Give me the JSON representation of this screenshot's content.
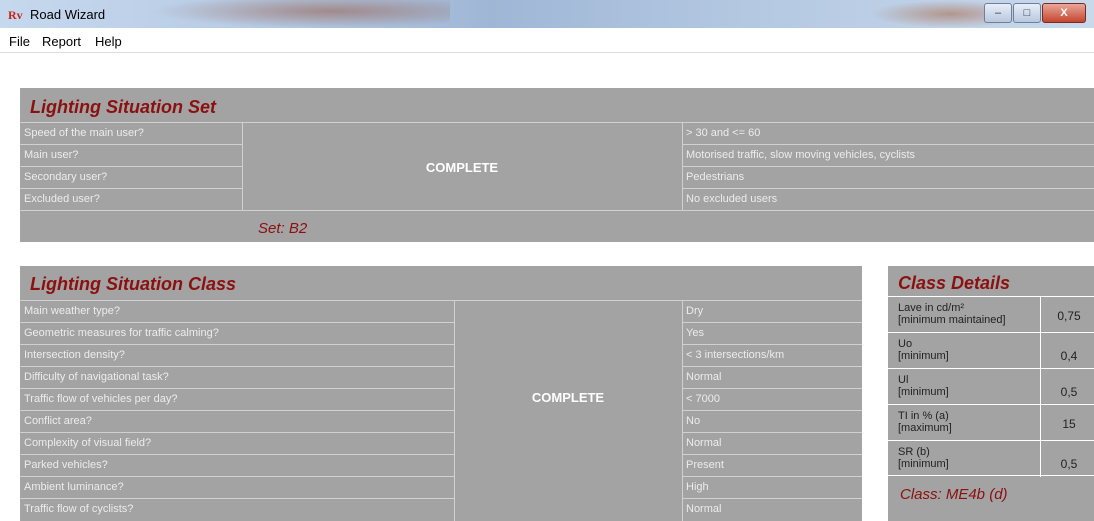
{
  "window": {
    "app_icon": "Rv",
    "title": "Road Wizard",
    "min": "–",
    "max": "□",
    "close": "X"
  },
  "menu": [
    "File",
    "Report",
    "Help"
  ],
  "set_panel": {
    "title": "Lighting Situation Set",
    "status": "COMPLETE",
    "rows": [
      {
        "question": "Speed of the main user?",
        "answer": "> 30 and <= 60"
      },
      {
        "question": "Main user?",
        "answer": "Motorised traffic, slow moving vehicles, cyclists"
      },
      {
        "question": "Secondary user?",
        "answer": "Pedestrians"
      },
      {
        "question": "Excluded user?",
        "answer": "No excluded users"
      }
    ],
    "result": "Set: B2"
  },
  "class_panel": {
    "title": "Lighting Situation Class",
    "status": "COMPLETE",
    "rows": [
      {
        "question": "Main weather type?",
        "answer": "Dry"
      },
      {
        "question": "Geometric measures for traffic calming?",
        "answer": "Yes"
      },
      {
        "question": "Intersection density?",
        "answer": "< 3 intersections/km"
      },
      {
        "question": "Difficulty of navigational task?",
        "answer": "Normal"
      },
      {
        "question": "Traffic flow of vehicles per day?",
        "answer": "< 7000"
      },
      {
        "question": "Conflict area?",
        "answer": "No"
      },
      {
        "question": "Complexity of visual field?",
        "answer": "Normal"
      },
      {
        "question": "Parked vehicles?",
        "answer": "Present"
      },
      {
        "question": "Ambient luminance?",
        "answer": "High"
      },
      {
        "question": "Traffic flow of cyclists?",
        "answer": "Normal"
      }
    ]
  },
  "details_panel": {
    "title": "Class Details",
    "rows": [
      {
        "line1": "Lave in cd/m²",
        "line2": "[minimum maintained]",
        "value": "0,75"
      },
      {
        "line1": "Uo",
        "line2": "[minimum]",
        "value": "0,4"
      },
      {
        "line1": "Ul",
        "line2": "[minimum]",
        "value": "0,5"
      },
      {
        "line1": "TI in % (a)",
        "line2": "[maximum]",
        "value": "15"
      },
      {
        "line1": "SR (b)",
        "line2": "[minimum]",
        "value": "0,5"
      }
    ],
    "result": "Class: ME4b (d)"
  }
}
